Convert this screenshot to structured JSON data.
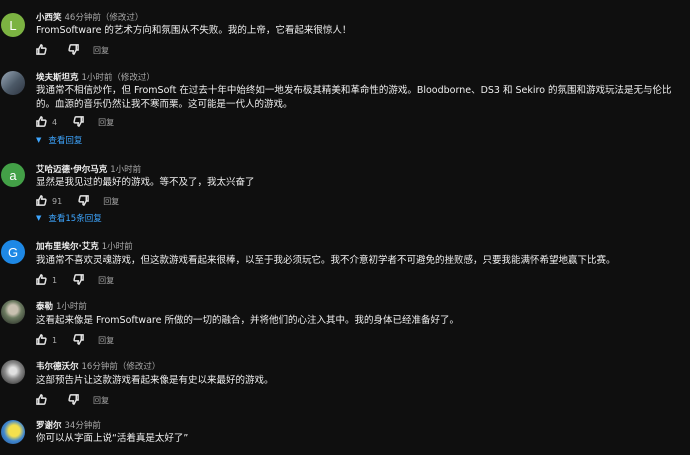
{
  "comments": [
    {
      "author": "小西笑",
      "time": "46分钟前（修改过）",
      "text": "FromSoftware 的艺术方向和氛围从不失败。我的上帝，它看起来很惊人！",
      "avatar": {
        "letter": "L",
        "color": "#7cb342"
      },
      "likes": "",
      "reply_label": "回复"
    },
    {
      "author": "埃夫斯坦克",
      "time": "1小时前（修改过）",
      "text": "我通常不相信炒作，但 FromSoft 在过去十年中始终如一地发布极其精美和革命性的游戏。Bloodborne、DS3 和 Sekiro 的氛围和游戏玩法是无与伦比的。血源的音乐仍然让我不寒而栗。这可能是一代人的游戏。",
      "avatar": {
        "letter": "",
        "color": "#6a7a8c"
      },
      "likes": "4",
      "reply_label": "回复",
      "replies_label": "查看回复"
    },
    {
      "author": "艾哈迈德·伊尔马克",
      "time": "1小时前",
      "text": "显然是我见过的最好的游戏。等不及了，我太兴奋了",
      "avatar": {
        "letter": "a",
        "color": "#43a047"
      },
      "likes": "91",
      "reply_label": "回复",
      "replies_label": "查看15条回复"
    },
    {
      "author": "加布里埃尔·艾克",
      "time": "1小时前",
      "text": "我通常不喜欢灵魂游戏，但这款游戏看起来很棒，以至于我必须玩它。我不介意初学者不可避免的挫败感，只要我能满怀希望地赢下比赛。",
      "avatar": {
        "letter": "G",
        "color": "#1e88e5"
      },
      "likes": "1",
      "reply_label": "回复"
    },
    {
      "author": "泰勒",
      "time": "1小时前",
      "text": "这看起来像是 FromSoftware 所做的一切的融合，并将他们的心注入其中。我的身体已经准备好了。",
      "avatar": {
        "letter": "",
        "color": "#5b6b54"
      },
      "likes": "1",
      "reply_label": "回复"
    },
    {
      "author": "韦尔德沃尔",
      "time": "16分钟前（修改过）",
      "text": "这部预告片让这款游戏看起来像是有史以来最好的游戏。",
      "avatar": {
        "letter": "",
        "color": "#9e9e9e"
      },
      "likes": "",
      "reply_label": "回复"
    },
    {
      "author": "罗谢尔",
      "time": "34分钟前",
      "text": "你可以从字面上说“活着真是太好了”",
      "avatar": {
        "letter": "",
        "color": "#4a8fd6"
      },
      "likes": "",
      "reply_label": ""
    }
  ]
}
